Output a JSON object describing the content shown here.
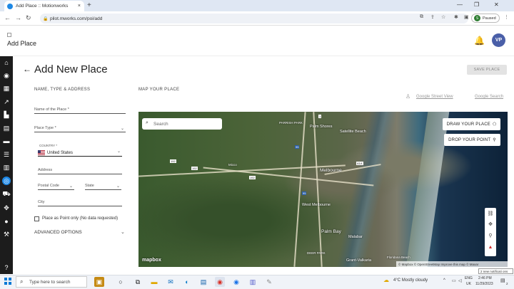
{
  "browser": {
    "tab_title": "Add Place :: Motionworks",
    "tab_close": "×",
    "new_tab": "+",
    "url": "pilot.mworks.com/poi/add",
    "profile_initial": "S",
    "profile_status": "Paused",
    "win_minimize": "—",
    "win_restore": "❐",
    "win_close": "✕"
  },
  "app": {
    "header_title": "Add Place",
    "user_initials": "VP"
  },
  "page": {
    "title": "Add New Place",
    "save_label": "SAVE PLACE",
    "section_left": "NAME, TYPE & ADDRESS",
    "section_map": "MAP YOUR PLACE",
    "street_view": "Google Street View",
    "google_search": "Google Search"
  },
  "form": {
    "name_label": "Name of the Place *",
    "type_label": "Place Type *",
    "country_label": "COUNTRY *",
    "country_value": "United States",
    "address_label": "Address",
    "postal_label": "Postal Code",
    "state_label": "State",
    "city_label": "City",
    "point_only_label": "Place as Point only (No data requested)",
    "advanced_label": "ADVANCED OPTIONS"
  },
  "map": {
    "search_placeholder": "Search",
    "draw_label": "DRAW YOUR PLACE",
    "drop_label": "DROP YOUR POINT",
    "logo": "mapbox",
    "attribution": "© Mapbox © OpenStreetMap Improve this map © Maxar",
    "labels": {
      "parrish_park": "PARRISH PARK",
      "palm_shores": "Palm Shores",
      "satellite_beach": "Satellite Beach",
      "melbourne": "Melbourne",
      "west_melbourne": "West Melbourne",
      "palm_bay": "Palm Bay",
      "malabar": "Malabar",
      "grant_valkaria": "Grant-Valkaria",
      "deer_park": "DEER PARK",
      "micco": "Micco",
      "floridana_beach": "Floridana Beach",
      "hwy_192a": "192",
      "hwy_192b": "192",
      "hwy_192c": "192",
      "i95a": "95",
      "i95b": "95",
      "hwy_a1a": "A1A",
      "hwy_1": "1"
    }
  },
  "taskbar": {
    "search_placeholder": "Type here to search",
    "weather": "4°C  Mostly cloudy",
    "lang_top": "ENG",
    "lang_bottom": "UK",
    "time": "2:46 PM",
    "date": "11/29/2023",
    "notification_count": "2",
    "notification_tip": "2 new notificati ons"
  }
}
